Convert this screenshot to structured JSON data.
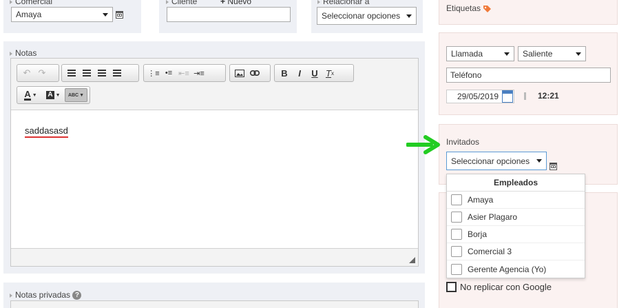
{
  "top_fields": {
    "comercial_label": "Comercial",
    "comercial_value": "Amaya",
    "cliente_label": "Cliente",
    "nuevo_label": "Nuevo",
    "relacionar_label": "Relacionar a",
    "relacionar_placeholder": "Seleccionar opciones"
  },
  "etiquetas_label": "Etiquetas",
  "notas": {
    "label": "Notas",
    "content": "saddasasd"
  },
  "notas_privadas": {
    "label": "Notas privadas"
  },
  "toolbar": {
    "undo": "↶",
    "redo": "↷",
    "bold": "B",
    "italic": "I",
    "underline": "U",
    "clear_format": "T",
    "text_color": "A",
    "bg_color": "A",
    "spellcheck": "ABC"
  },
  "call": {
    "type_value": "Llamada",
    "direction_value": "Saliente",
    "channel_value": "Teléfono",
    "date_value": "29/05/2019",
    "time_value": "12:21"
  },
  "invitados": {
    "label": "Invitados",
    "placeholder": "Seleccionar opciones",
    "group_header": "Empleados",
    "options": [
      "Amaya",
      "Asier Plagaro",
      "Borja",
      "Comercial 3",
      "Gerente Agencia (Yo)"
    ]
  },
  "no_replicar_label": "No replicar con Google",
  "colors": {
    "arrow": "#22cc22",
    "tag_icon": "#f07a3a",
    "spell_underline": "#dd3333"
  }
}
